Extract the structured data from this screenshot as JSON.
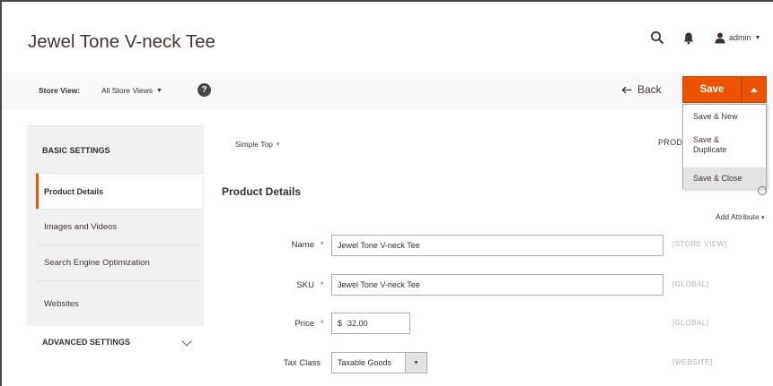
{
  "header": {
    "page_title": "Jewel Tone V-neck Tee",
    "user_name": "admin",
    "icons": [
      "search-icon",
      "bell-icon",
      "user-icon"
    ]
  },
  "toolbar": {
    "store_view_label": "Store View:",
    "store_view_value": "All Store Views",
    "help_glyph": "?",
    "back_label": "Back",
    "save_label": "Save",
    "save_menu": [
      "Save & New",
      "Save & Duplicate",
      "Save & Close"
    ],
    "accent_color": "#eb5202"
  },
  "nav": {
    "basic_settings": "BASIC SETTINGS",
    "items": [
      "Product Details",
      "Images and Videos",
      "Search Engine Optimization",
      "Websites"
    ],
    "active_item": "Product Details",
    "advanced_settings": "ADVANCED SETTINGS"
  },
  "main": {
    "attribute_set": "Simple Top",
    "prod_label_cut": "PROD",
    "section_title": "Product Details",
    "add_attribute": "Add Attribute",
    "fields": {
      "name": {
        "label": "Name",
        "value": "Jewel Tone V-neck Tee",
        "scope": "[STORE VIEW]"
      },
      "sku": {
        "label": "SKU",
        "value": "Jewel Tone V-neck Tee",
        "scope": "[GLOBAL]"
      },
      "price": {
        "label": "Price",
        "currency": "$",
        "value": "32.00",
        "scope": "[GLOBAL]"
      },
      "tax_class": {
        "label": "Tax Class",
        "value": "Taxable Goods",
        "scope": "[WEBSITE]"
      }
    },
    "required_mark": "*"
  }
}
